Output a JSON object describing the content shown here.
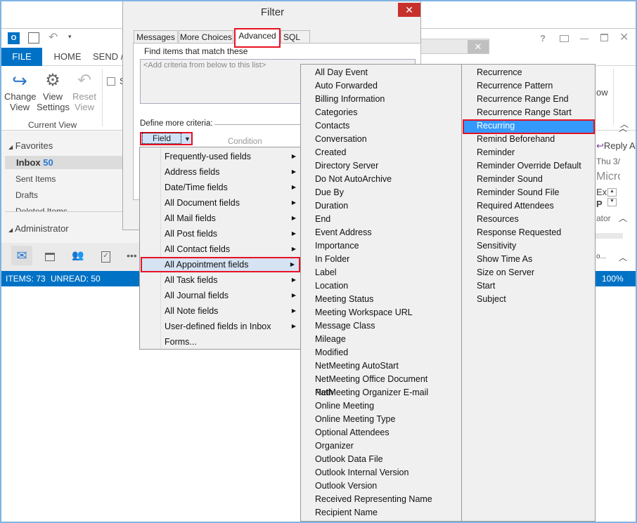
{
  "outlook": {
    "ribbon_tabs": [
      "FILE",
      "HOME",
      "SEND /"
    ],
    "ribbon": {
      "change_view": "Change",
      "change_view2": "View",
      "view_settings": "View",
      "view_settings2": "Settings",
      "reset_view": "Reset",
      "reset_view2": "View",
      "group": "Current View",
      "show_fragment": "S",
      "show_fragment2": "ow"
    },
    "nav": {
      "favorites": "Favorites",
      "inbox": "Inbox",
      "inbox_count": "50",
      "sent": "Sent Items",
      "drafts": "Drafts",
      "deleted": "Deleted Items",
      "account": "Administrator"
    },
    "status": {
      "items": "ITEMS: 73",
      "unread": "UNREAD: 50",
      "zoom": "100%"
    },
    "reading": {
      "reply": "Reply A",
      "date": "Thu 3/",
      "sender": "Micro",
      "ex": "Ex",
      "p": "P",
      "ator": "ator",
      "o": "o..."
    },
    "accent": "#0072c6"
  },
  "filter": {
    "title": "Filter",
    "tabs": [
      "Messages",
      "More Choices",
      "Advanced",
      "SQL"
    ],
    "active_tab": "Advanced",
    "find_label": "Find items that match these",
    "criteria_placeholder": "<Add criteria from below to this list>",
    "define_label": "Define more criteria:",
    "field_button": "Field",
    "condition_label": "Condition"
  },
  "field_menu": {
    "items": [
      "Frequently-used fields",
      "Address fields",
      "Date/Time fields",
      "All Document fields",
      "All Mail fields",
      "All Post fields",
      "All Contact fields",
      "All Appointment fields",
      "All Task fields",
      "All Journal fields",
      "All Note fields",
      "User-defined fields in Inbox",
      "Forms..."
    ],
    "selected": "All Appointment fields"
  },
  "submenu": {
    "col1": [
      "All Day Event",
      "Auto Forwarded",
      "Billing Information",
      "Categories",
      "Contacts",
      "Conversation",
      "Created",
      "Directory Server",
      "Do Not AutoArchive",
      "Due By",
      "Duration",
      "End",
      "Event Address",
      "Importance",
      "In Folder",
      "Label",
      "Location",
      "Meeting Status",
      "Meeting Workspace URL",
      "Message Class",
      "Mileage",
      "Modified",
      "NetMeeting AutoStart",
      "NetMeeting Office Document Path",
      "NetMeeting Organizer E-mail",
      "Online Meeting",
      "Online Meeting Type",
      "Optional Attendees",
      "Organizer",
      "Outlook Data File",
      "Outlook Internal Version",
      "Outlook Version",
      "Received Representing Name",
      "Recipient Name"
    ],
    "col2": [
      "Recurrence",
      "Recurrence Pattern",
      "Recurrence Range End",
      "Recurrence Range Start",
      "Recurring",
      "Remind Beforehand",
      "Reminder",
      "Reminder Override Default",
      "Reminder Sound",
      "Reminder Sound File",
      "Required Attendees",
      "Resources",
      "Response Requested",
      "Sensitivity",
      "Show Time As",
      "Size on Server",
      "Start",
      "Subject"
    ],
    "selected": "Recurring",
    "highlight_color": "#3399ff"
  }
}
